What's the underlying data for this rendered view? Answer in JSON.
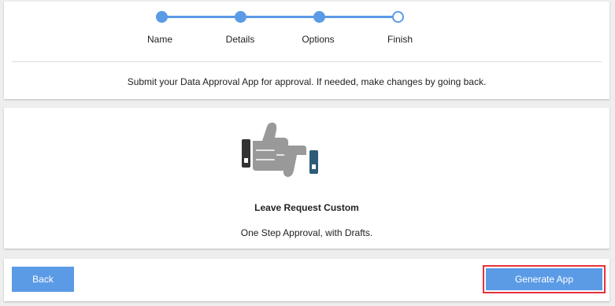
{
  "wizard": {
    "steps": [
      {
        "label": "Name",
        "state": "complete"
      },
      {
        "label": "Details",
        "state": "complete"
      },
      {
        "label": "Options",
        "state": "complete"
      },
      {
        "label": "Finish",
        "state": "current"
      }
    ],
    "instructions": "Submit your Data Approval App for approval. If needed, make changes by going back."
  },
  "app": {
    "icon": "thumbs-up-down-icon",
    "name": "Leave Request Custom",
    "description": "One Step Approval, with Drafts."
  },
  "actions": {
    "back_label": "Back",
    "generate_label": "Generate App"
  },
  "colors": {
    "accent": "#5b9be6",
    "highlight_border": "#e8323c",
    "icon_gray": "#999999",
    "icon_dark": "#333333",
    "icon_teal": "#2e5b78"
  }
}
